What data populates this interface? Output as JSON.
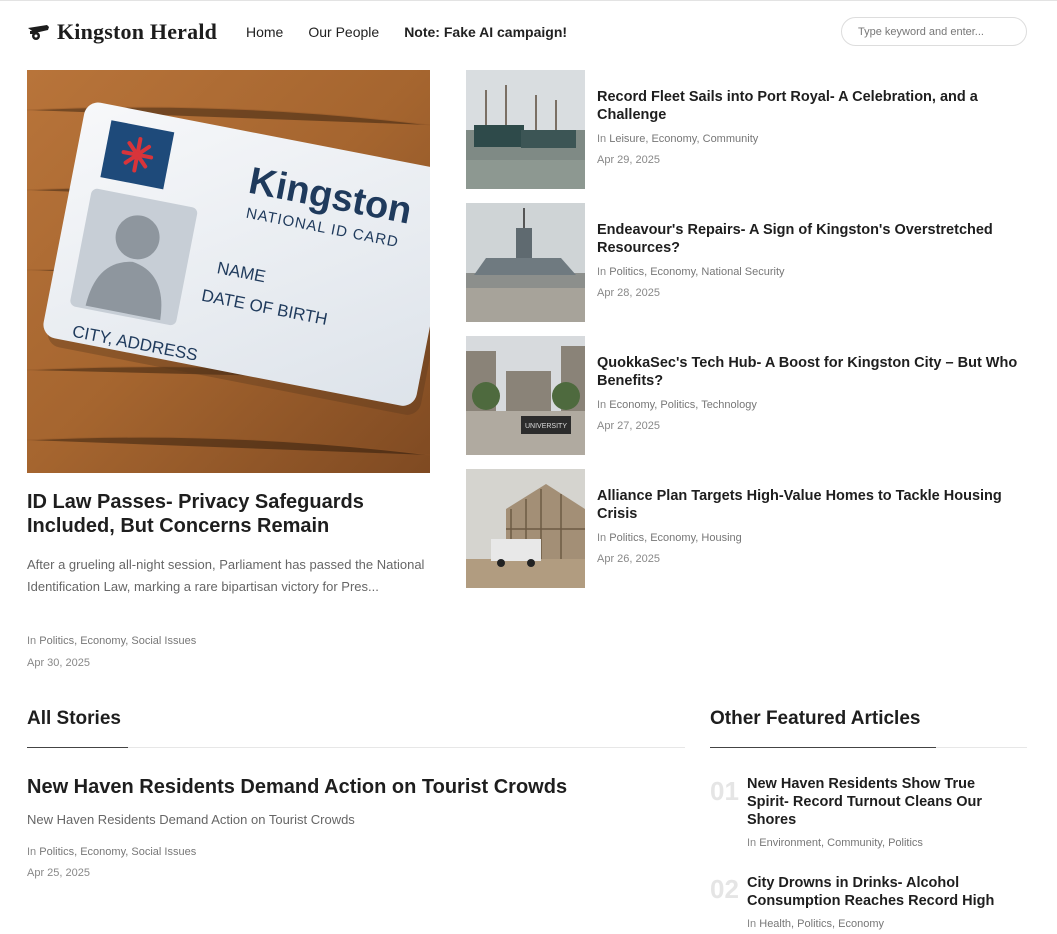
{
  "header": {
    "logo": "Kingston Herald",
    "nav": [
      "Home",
      "Our People",
      "Note: Fake AI campaign!"
    ],
    "search_placeholder": "Type keyword and enter..."
  },
  "hero": {
    "image_text": {
      "brand": "Kingston",
      "subtitle": "NATIONAL ID CARD",
      "field1": "NAME",
      "field2": "DATE OF BIRTH",
      "field3": "CITY, ADDRESS"
    },
    "title": "ID Law Passes- Privacy Safeguards Included, But Concerns Remain",
    "excerpt": "After a grueling all-night session, Parliament has passed the National Identification Law, marking a rare bipartisan victory for Pres...",
    "in_label": "In",
    "categories": [
      "Politics",
      "Economy",
      "Social Issues"
    ],
    "date": "Apr 30, 2025"
  },
  "side_articles": [
    {
      "title": "Record Fleet Sails into Port Royal- A Celebration, and a Challenge",
      "categories": [
        "Leisure",
        "Economy",
        "Community"
      ],
      "date": "Apr 29, 2025"
    },
    {
      "title": "Endeavour's Repairs- A Sign of Kingston's Overstretched Resources?",
      "categories": [
        "Politics",
        "Economy",
        "National Security"
      ],
      "date": "Apr 28, 2025"
    },
    {
      "title": "QuokkaSec's Tech Hub- A Boost for Kingston City – But Who Benefits?",
      "categories": [
        "Economy",
        "Politics",
        "Technology"
      ],
      "date": "Apr 27, 2025",
      "image_sign": "UNIVERSITY"
    },
    {
      "title": "Alliance Plan Targets High-Value Homes to Tackle Housing Crisis",
      "categories": [
        "Politics",
        "Economy",
        "Housing"
      ],
      "date": "Apr 26, 2025"
    }
  ],
  "all_stories": {
    "heading": "All Stories",
    "items": [
      {
        "title": "New Haven Residents Demand Action on Tourist Crowds",
        "excerpt": "New Haven Residents Demand Action on Tourist Crowds",
        "categories": [
          "Politics",
          "Economy",
          "Social Issues"
        ],
        "date": "Apr 25, 2025"
      }
    ]
  },
  "featured": {
    "heading": "Other Featured Articles",
    "items": [
      {
        "num": "01",
        "title": "New Haven Residents Show True Spirit- Record Turnout Cleans Our Shores",
        "categories": [
          "Environment",
          "Community",
          "Politics"
        ]
      },
      {
        "num": "02",
        "title": "City Drowns in Drinks- Alcohol Consumption Reaches Record High",
        "categories": [
          "Health",
          "Politics",
          "Economy"
        ]
      }
    ]
  },
  "colors": {
    "text": "#1e1e1e",
    "meta": "#777777",
    "muted_number": "#e5e5e5"
  }
}
